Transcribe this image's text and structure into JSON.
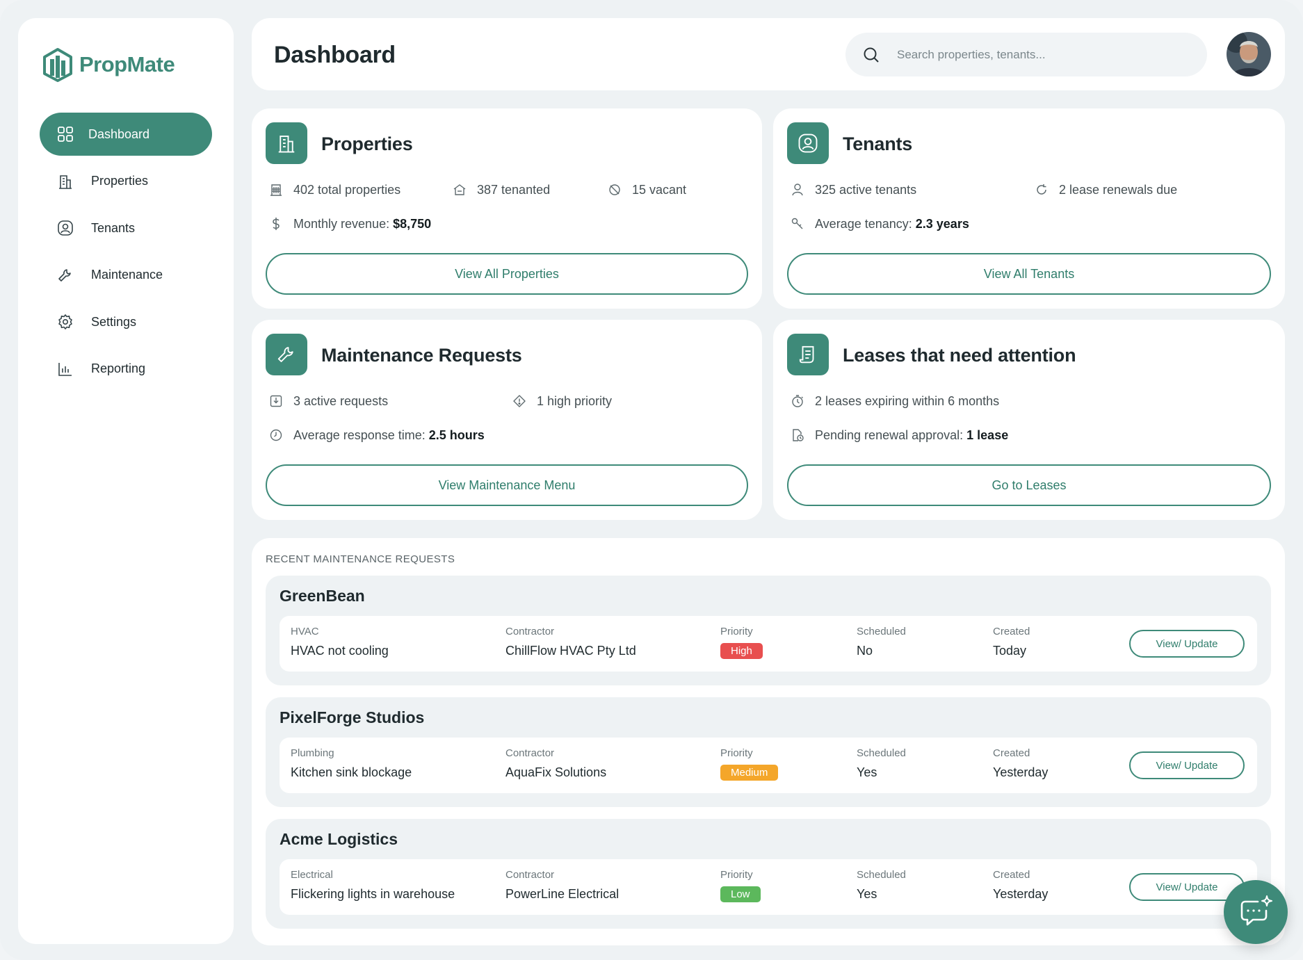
{
  "app": {
    "name": "PropMate",
    "brand_color": "#3e8a79"
  },
  "sidebar": {
    "items": [
      {
        "label": "Dashboard",
        "icon": "grid-icon",
        "active": true
      },
      {
        "label": "Properties",
        "icon": "building-icon"
      },
      {
        "label": "Tenants",
        "icon": "user-circle-icon"
      },
      {
        "label": "Maintenance",
        "icon": "wrench-icon"
      },
      {
        "label": "Settings",
        "icon": "gear-icon"
      },
      {
        "label": "Reporting",
        "icon": "bar-chart-icon"
      }
    ]
  },
  "header": {
    "title": "Dashboard",
    "search_placeholder": "Search properties, tenants..."
  },
  "cards": {
    "properties": {
      "title": "Properties",
      "stats": {
        "total": "402 total properties",
        "tenanted": "387 tenanted",
        "vacant": "15 vacant",
        "revenue_label": "Monthly revenue:",
        "revenue_value": "$8,750"
      },
      "button": "View All Properties"
    },
    "tenants": {
      "title": "Tenants",
      "stats": {
        "active": "325 active tenants",
        "renewals": "2 lease renewals due",
        "tenancy_label": "Average tenancy:",
        "tenancy_value": "2.3 years"
      },
      "button": "View All Tenants"
    },
    "maintenance": {
      "title": "Maintenance Requests",
      "stats": {
        "active": "3 active requests",
        "priority": "1 high priority",
        "response_label": "Average response time:",
        "response_value": "2.5 hours"
      },
      "button": "View Maintenance Menu"
    },
    "leases": {
      "title": "Leases that need attention",
      "stats": {
        "expiring": "2 leases expiring within 6 months",
        "pending_label": "Pending renewal approval:",
        "pending_value": "1 lease"
      },
      "button": "Go to Leases"
    }
  },
  "recent": {
    "heading": "RECENT MAINTENANCE REQUESTS",
    "labels": {
      "contractor": "Contractor",
      "priority": "Priority",
      "scheduled": "Scheduled",
      "created": "Created",
      "button": "View/  Update"
    },
    "requests": [
      {
        "tenant": "GreenBean",
        "category": "HVAC",
        "issue": "HVAC not cooling",
        "contractor": "ChillFlow HVAC Pty Ltd",
        "priority": "High",
        "priority_color": "#e84f4f",
        "scheduled": "No",
        "created": "Today"
      },
      {
        "tenant": "PixelForge Studios",
        "category": "Plumbing",
        "issue": "Kitchen sink blockage",
        "contractor": "AquaFix Solutions",
        "priority": "Medium",
        "priority_color": "#f4a62a",
        "scheduled": "Yes",
        "created": "Yesterday"
      },
      {
        "tenant": "Acme Logistics",
        "category": "Electrical",
        "issue": "Flickering lights in warehouse",
        "contractor": "PowerLine Electrical",
        "priority": "Low",
        "priority_color": "#5cb85c",
        "scheduled": "Yes",
        "created": "Yesterday"
      }
    ]
  }
}
